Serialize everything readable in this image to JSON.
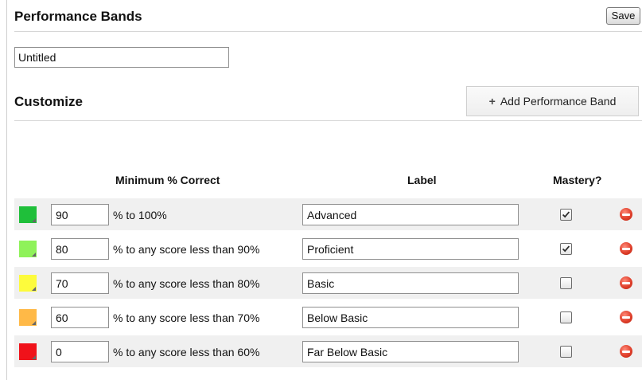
{
  "header": {
    "title": "Performance Bands",
    "save_label": "Save"
  },
  "name_field": {
    "value": "Untitled"
  },
  "customize": {
    "title": "Customize",
    "add_label": "Add Performance Band"
  },
  "columns": {
    "minimum": "Minimum % Correct",
    "label": "Label",
    "mastery": "Mastery?"
  },
  "bands": [
    {
      "color": "#1fbf3a",
      "minimum": "90",
      "range_text": "% to 100%",
      "label": "Advanced",
      "mastery": true
    },
    {
      "color": "#8ff25a",
      "minimum": "80",
      "range_text": "% to any score less than 90%",
      "label": "Proficient",
      "mastery": true
    },
    {
      "color": "#fdfb3c",
      "minimum": "70",
      "range_text": "% to any score less than 80%",
      "label": "Basic",
      "mastery": false
    },
    {
      "color": "#ffb947",
      "minimum": "60",
      "range_text": "% to any score less than 70%",
      "label": "Below Basic",
      "mastery": false
    },
    {
      "color": "#f0121a",
      "minimum": "0",
      "range_text": "% to any score less than 60%",
      "label": "Far Below Basic",
      "mastery": false
    }
  ]
}
